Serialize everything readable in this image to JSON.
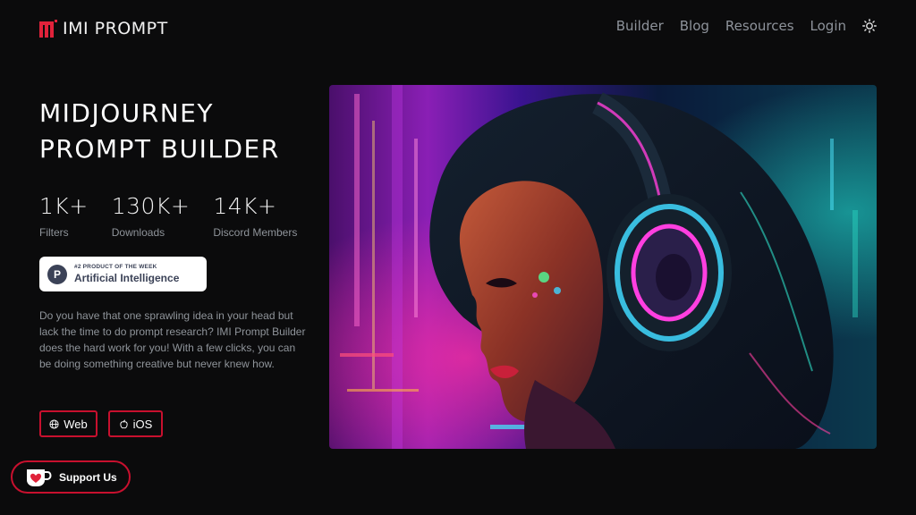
{
  "header": {
    "logo_text": "IMI PROMPT",
    "nav": [
      {
        "label": "Builder"
      },
      {
        "label": "Blog"
      },
      {
        "label": "Resources"
      },
      {
        "label": "Login"
      }
    ],
    "theme_icon": "sun-icon"
  },
  "hero": {
    "title_line1": "MIDJOURNEY",
    "title_line2": "PROMPT BUILDER",
    "stats": [
      {
        "value": "1K+",
        "label": "Filters"
      },
      {
        "value": "130K+",
        "label": "Downloads"
      },
      {
        "value": "14K+",
        "label": "Discord Members"
      }
    ],
    "badge": {
      "icon_letter": "P",
      "small": "#2 PRODUCT OF THE WEEK",
      "main": "Artificial Intelligence"
    },
    "description": "Do you have that one sprawling idea in your head but lack the time to do prompt research? IMI Prompt Builder does the hard work for you! With a few clicks, you can be doing something creative but never knew how.",
    "buttons": {
      "web": "Web",
      "ios": "iOS"
    }
  },
  "support": {
    "label": "Support Us"
  },
  "colors": {
    "background": "#0b0b0c",
    "accent": "#c8102e",
    "muted_text": "#8f949a"
  }
}
